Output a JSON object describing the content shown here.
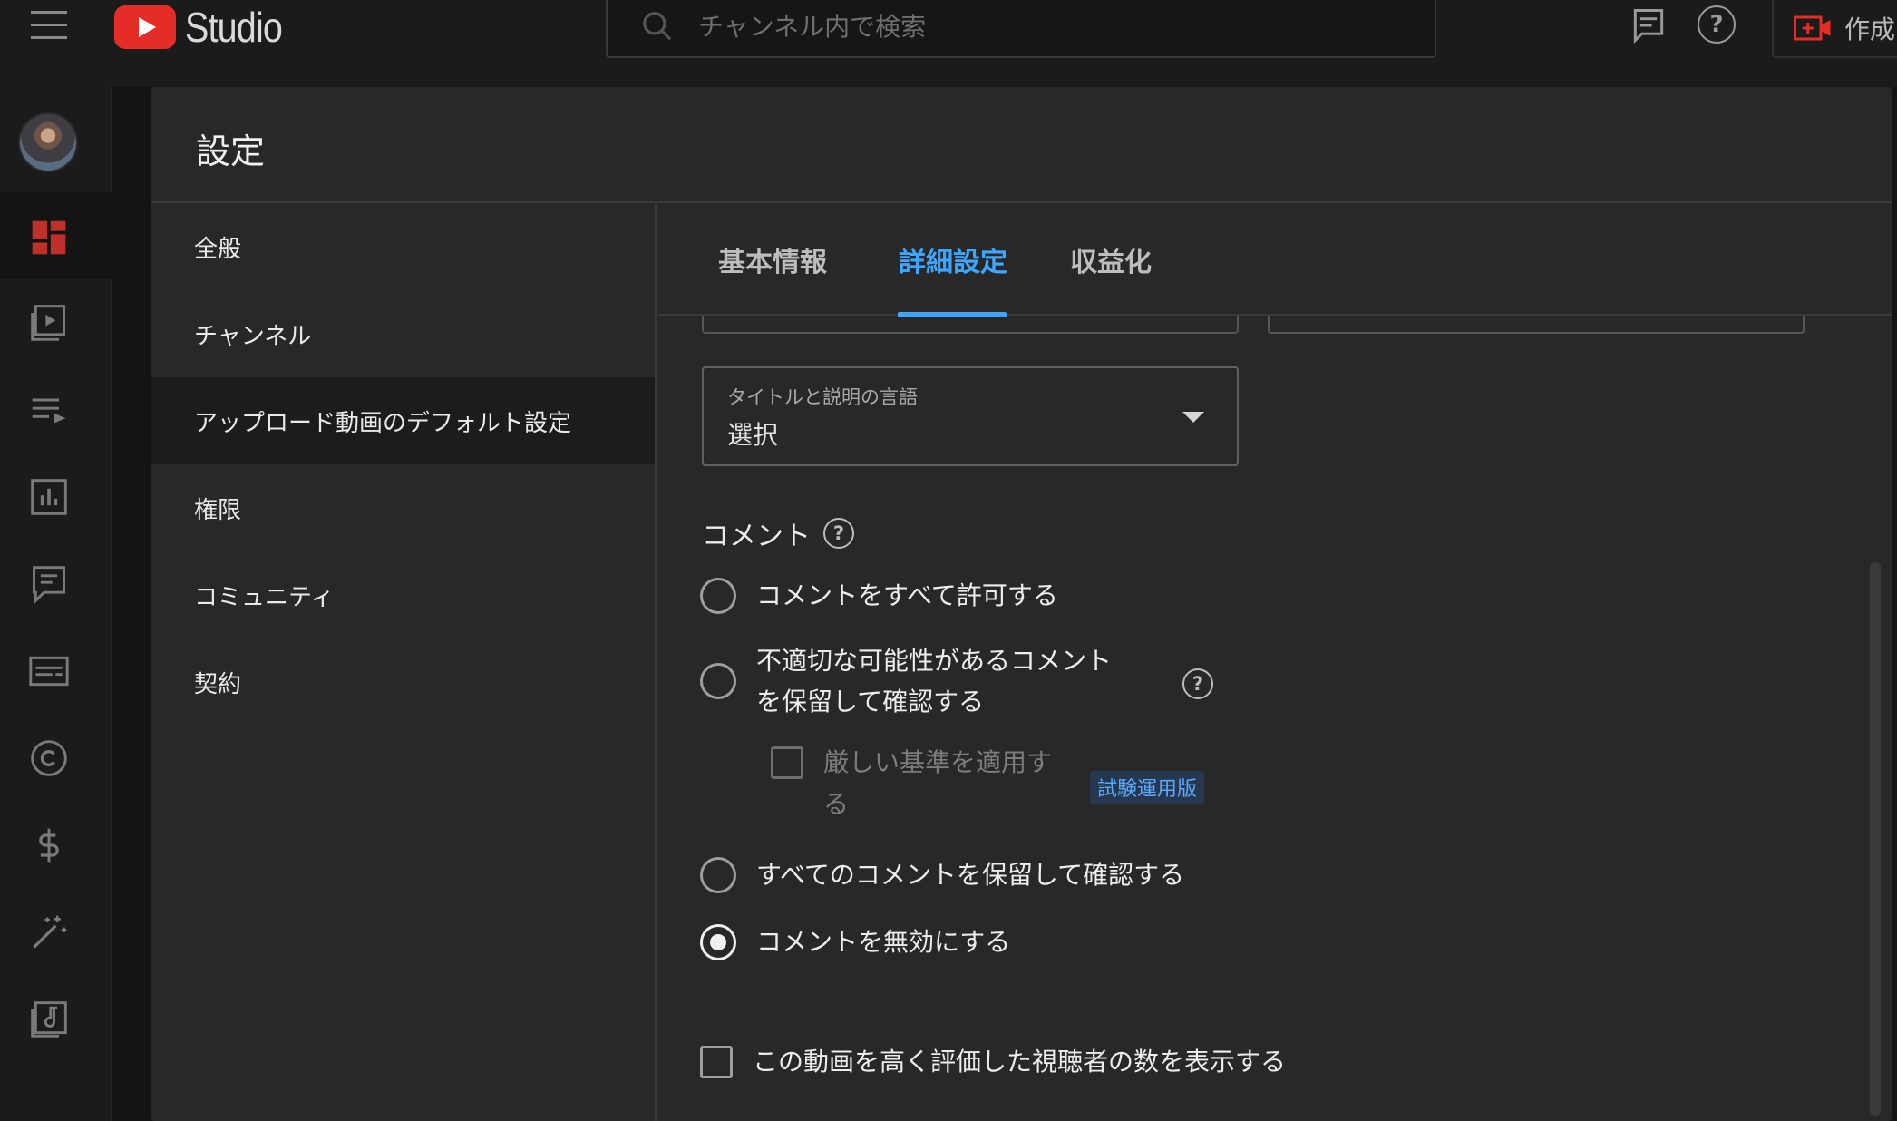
{
  "app": {
    "brand": "Studio",
    "search_placeholder": "チャンネル内で検索",
    "create_label": "作成",
    "colors": {
      "accent": "#3ea6ff",
      "brand_red": "#e52d27"
    }
  },
  "rail": {
    "icons": [
      "dashboard-icon",
      "content-icon",
      "playlists-icon",
      "analytics-icon",
      "comments-icon",
      "subtitles-icon",
      "copyright-icon",
      "monetization-icon",
      "customization-icon",
      "audio-library-icon"
    ]
  },
  "modal": {
    "title": "設定",
    "nav": [
      {
        "label": "全般"
      },
      {
        "label": "チャンネル"
      },
      {
        "label": "アップロード動画のデフォルト設定",
        "active": true
      },
      {
        "label": "権限"
      },
      {
        "label": "コミュニティ"
      },
      {
        "label": "契約"
      }
    ],
    "tabs": [
      {
        "label": "基本情報"
      },
      {
        "label": "詳細設定",
        "active": true
      },
      {
        "label": "収益化"
      }
    ],
    "language_select": {
      "label": "タイトルと説明の言語",
      "value": "選択"
    },
    "comments": {
      "heading": "コメント",
      "options": [
        {
          "label": "コメントをすべて許可する",
          "checked": false
        },
        {
          "label_line1": "不適切な可能性があるコメント",
          "label_line2": "を保留して確認する",
          "checked": false
        },
        {
          "label": "すべてのコメントを保留して確認する",
          "checked": false
        },
        {
          "label": "コメントを無効にする",
          "checked": true
        }
      ],
      "strict": {
        "label_line1": "厳しい基準を適用す",
        "label_line2": "る",
        "badge": "試験運用版",
        "checked": false
      }
    },
    "show_likes": {
      "label": "この動画を高く評価した視聴者の数を表示する",
      "checked": false
    }
  }
}
